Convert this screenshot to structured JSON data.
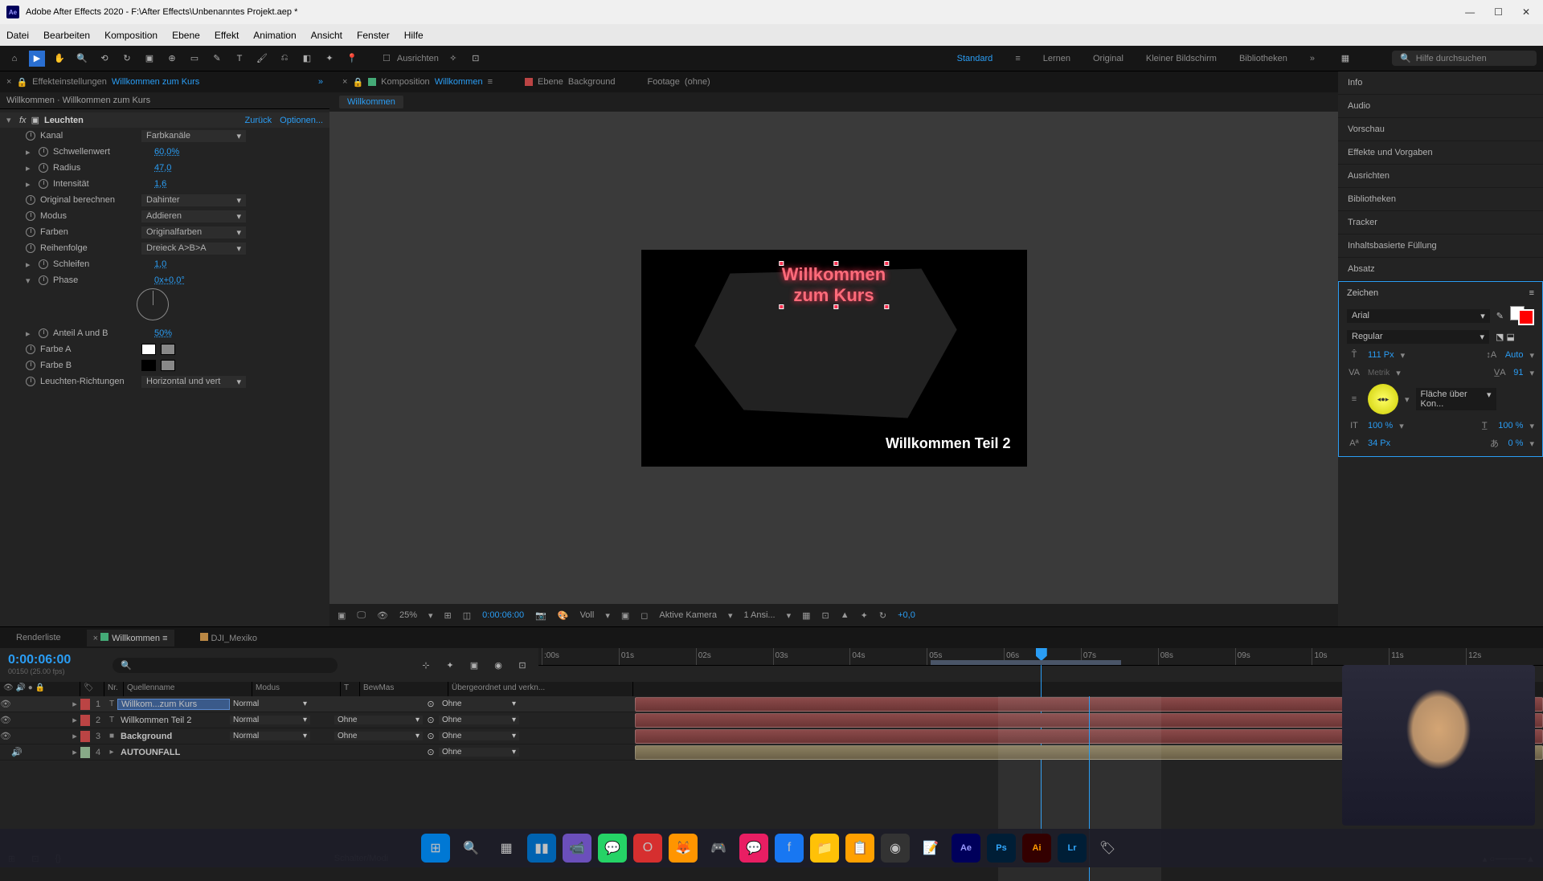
{
  "titlebar": {
    "app": "Adobe After Effects 2020",
    "path": "F:\\After Effects\\Unbenanntes Projekt.aep *"
  },
  "menu": [
    "Datei",
    "Bearbeiten",
    "Komposition",
    "Ebene",
    "Effekt",
    "Animation",
    "Ansicht",
    "Fenster",
    "Hilfe"
  ],
  "toolbar": {
    "align": "Ausrichten"
  },
  "workspaces": [
    "Standard",
    "Lernen",
    "Original",
    "Kleiner Bildschirm",
    "Bibliotheken"
  ],
  "search": {
    "placeholder": "Hilfe durchsuchen"
  },
  "effectPanel": {
    "tab": "Effekteinstellungen",
    "compName": "Willkommen zum Kurs",
    "breadcrumb": "Willkommen · Willkommen zum Kurs",
    "effectName": "Leuchten",
    "back": "Zurück",
    "options": "Optionen...",
    "props": {
      "kanal": {
        "label": "Kanal",
        "val": "Farbkanäle"
      },
      "schwellenwert": {
        "label": "Schwellenwert",
        "val": "60,0%"
      },
      "radius": {
        "label": "Radius",
        "val": "47,0"
      },
      "intensitaet": {
        "label": "Intensität",
        "val": "1,6"
      },
      "original": {
        "label": "Original berechnen",
        "val": "Dahinter"
      },
      "modus": {
        "label": "Modus",
        "val": "Addieren"
      },
      "farben": {
        "label": "Farben",
        "val": "Originalfarben"
      },
      "reihenfolge": {
        "label": "Reihenfolge",
        "val": "Dreieck A>B>A"
      },
      "schleifen": {
        "label": "Schleifen",
        "val": "1,0"
      },
      "phase": {
        "label": "Phase",
        "val": "0x+0,0°"
      },
      "anteil": {
        "label": "Anteil A und B",
        "val": "50%"
      },
      "farbeA": {
        "label": "Farbe A"
      },
      "farbeB": {
        "label": "Farbe B"
      },
      "richtung": {
        "label": "Leuchten-Richtungen",
        "val": "Horizontal und vert"
      }
    }
  },
  "compTabs": {
    "comp": {
      "label": "Komposition",
      "name": "Willkommen"
    },
    "layer": {
      "label": "Ebene",
      "name": "Background"
    },
    "footage": {
      "label": "Footage",
      "name": "(ohne)"
    },
    "flow": "Willkommen"
  },
  "viewer": {
    "text1a": "Willkommen",
    "text1b": "zum Kurs",
    "text2": "Willkommen Teil 2",
    "zoom": "25%",
    "time": "0:00:06:00",
    "res": "Voll",
    "view": "Aktive Kamera",
    "ansicht": "1 Ansi...",
    "exp": "+0,0"
  },
  "rightPanels": [
    "Info",
    "Audio",
    "Vorschau",
    "Effekte und Vorgaben",
    "Ausrichten",
    "Bibliotheken",
    "Tracker",
    "Inhaltsbasierte Füllung",
    "Absatz"
  ],
  "char": {
    "title": "Zeichen",
    "font": "Arial",
    "style": "Regular",
    "size": "111 Px",
    "leading": "Auto",
    "kerning": "Metrik",
    "tracking": "91",
    "stroke": "Fläche über Kon...",
    "vscale": "100 %",
    "hscale": "100 %",
    "baseline": "34 Px",
    "tsume": "0 %"
  },
  "timeline": {
    "tabs": {
      "render": "Renderliste",
      "comp": "Willkommen",
      "dji": "DJI_Mexiko"
    },
    "time": "0:00:06:00",
    "sub": "00150 (25.00 fps)",
    "cols": {
      "nr": "Nr.",
      "name": "Quellenname",
      "modus": "Modus",
      "t": "T",
      "bewmas": "BewMas",
      "ueber": "Übergeordnet und verkn..."
    },
    "layers": [
      {
        "n": "1",
        "name": "Willkom...zum Kurs",
        "mode": "Normal",
        "bew": "",
        "p": "Ohne",
        "type": "T",
        "color": "#b44"
      },
      {
        "n": "2",
        "name": "Willkommen Teil 2",
        "mode": "Normal",
        "bew": "Ohne",
        "p": "Ohne",
        "type": "T",
        "color": "#b44"
      },
      {
        "n": "3",
        "name": "Background",
        "mode": "Normal",
        "bew": "Ohne",
        "p": "Ohne",
        "type": "■",
        "color": "#b44"
      },
      {
        "n": "4",
        "name": "AUTOUNFALL",
        "mode": "",
        "bew": "",
        "p": "Ohne",
        "type": "▸",
        "color": "#8a8"
      }
    ],
    "ruler": [
      ":00s",
      "01s",
      "02s",
      "03s",
      "04s",
      "05s",
      "06s",
      "07s",
      "08s",
      "09s",
      "10s",
      "11s",
      "12s"
    ],
    "footer": "Schalter/Modi"
  }
}
